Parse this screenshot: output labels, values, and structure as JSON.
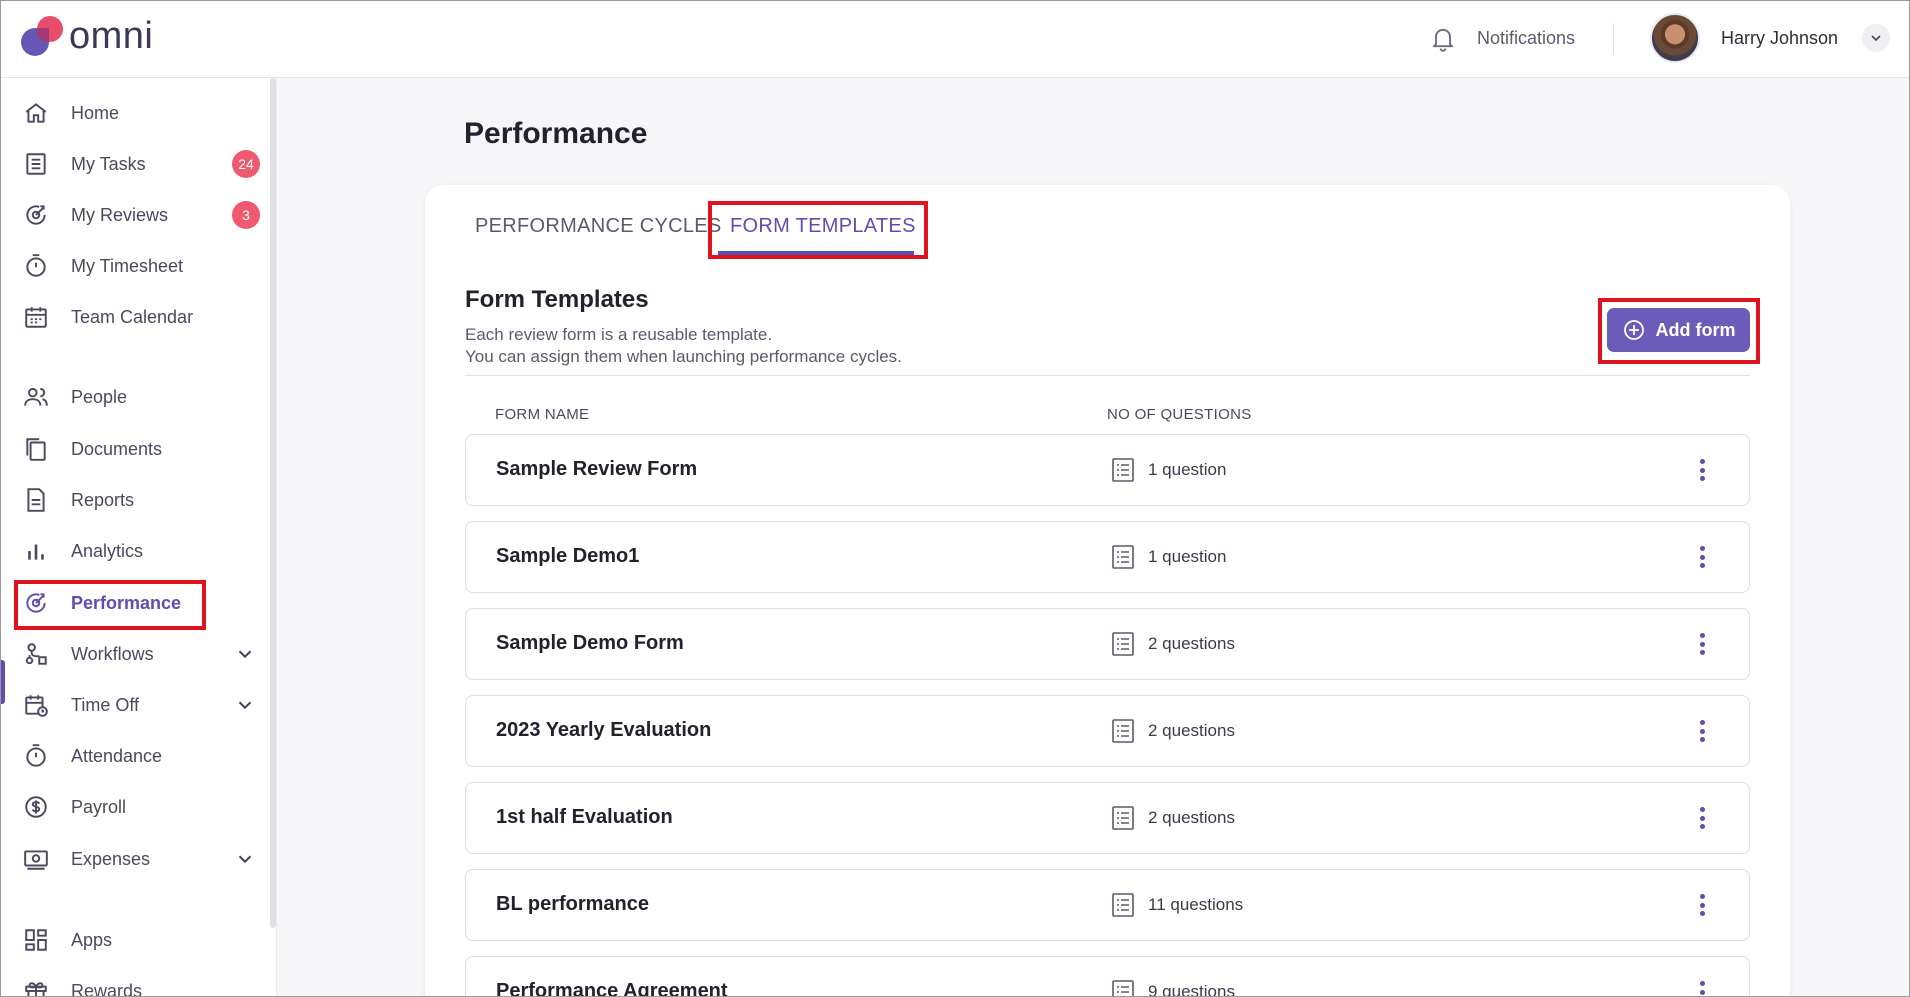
{
  "app": {
    "logo_text": "omni",
    "notifications_label": "Notifications",
    "user_name": "Harry Johnson"
  },
  "sidebar": {
    "items": [
      {
        "label": "Home",
        "icon": "home-icon"
      },
      {
        "label": "My Tasks",
        "icon": "tasks-icon",
        "badge": "24"
      },
      {
        "label": "My Reviews",
        "icon": "reviews-icon",
        "badge": "3"
      },
      {
        "label": "My Timesheet",
        "icon": "timer-icon"
      },
      {
        "label": "Team Calendar",
        "icon": "calendar-icon"
      },
      {
        "label": "People",
        "icon": "people-icon"
      },
      {
        "label": "Documents",
        "icon": "documents-icon"
      },
      {
        "label": "Reports",
        "icon": "reports-icon"
      },
      {
        "label": "Analytics",
        "icon": "analytics-icon"
      },
      {
        "label": "Performance",
        "icon": "performance-icon",
        "active": true
      },
      {
        "label": "Workflows",
        "icon": "workflows-icon",
        "expandable": true
      },
      {
        "label": "Time Off",
        "icon": "time-off-icon",
        "expandable": true
      },
      {
        "label": "Attendance",
        "icon": "attendance-icon"
      },
      {
        "label": "Payroll",
        "icon": "payroll-icon"
      },
      {
        "label": "Expenses",
        "icon": "expenses-icon",
        "expandable": true
      },
      {
        "label": "Apps",
        "icon": "apps-icon"
      },
      {
        "label": "Rewards",
        "icon": "rewards-icon"
      }
    ]
  },
  "main": {
    "page_title": "Performance",
    "tabs": [
      {
        "label": "PERFORMANCE CYCLES",
        "active": false
      },
      {
        "label": "FORM TEMPLATES",
        "active": true
      }
    ],
    "section": {
      "title": "Form Templates",
      "desc_line1": "Each review form is a reusable template.",
      "desc_line2": "You can assign them when launching performance cycles.",
      "add_button": "Add form"
    },
    "columns": [
      "FORM NAME",
      "NO OF QUESTIONS"
    ],
    "rows": [
      {
        "name": "Sample Review Form",
        "questions": "1 question"
      },
      {
        "name": "Sample Demo1",
        "questions": "1 question"
      },
      {
        "name": "Sample Demo Form",
        "questions": "2 questions"
      },
      {
        "name": "2023 Yearly Evaluation",
        "questions": "2 questions"
      },
      {
        "name": "1st half Evaluation",
        "questions": "2 questions"
      },
      {
        "name": "BL performance",
        "questions": "11 questions"
      },
      {
        "name": "Performance Agreement",
        "questions": "9 questions"
      }
    ]
  },
  "colors": {
    "accent": "#5b4fb0",
    "button": "#6a5cb8",
    "badge": "#ef5a6f",
    "highlight": "#e0121f"
  }
}
